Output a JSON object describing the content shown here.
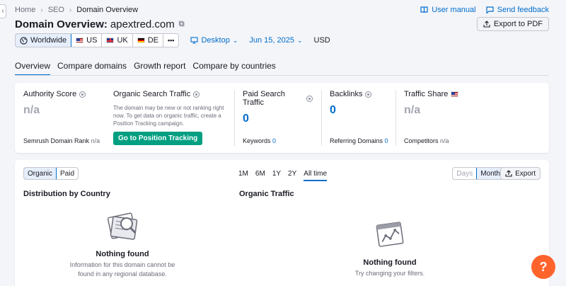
{
  "breadcrumb": [
    "Home",
    "SEO",
    "Domain Overview"
  ],
  "top_links": {
    "manual": "User manual",
    "feedback": "Send feedback"
  },
  "title": {
    "label": "Domain Overview:",
    "domain": "apextred.com"
  },
  "export_pdf": "Export to PDF",
  "regions": {
    "worldwide": "Worldwide",
    "us": "US",
    "uk": "UK",
    "de": "DE",
    "more": "•••"
  },
  "device": "Desktop",
  "date": "Jun 15, 2025",
  "currency": "USD",
  "tabs": [
    "Overview",
    "Compare domains",
    "Growth report",
    "Compare by countries"
  ],
  "metrics": {
    "authority": {
      "label": "Authority Score",
      "value": "n/a",
      "sub_label": "Semrush Domain Rank",
      "sub_value": "n/a"
    },
    "organic": {
      "label": "Organic Search Traffic",
      "note": "The domain may be new or not ranking right now. To get data on organic traffic, create a Position Tracking campaign.",
      "button": "Go to Position Tracking"
    },
    "paid": {
      "label": "Paid Search Traffic",
      "value": "0",
      "sub_label": "Keywords",
      "sub_value": "0"
    },
    "backlinks": {
      "label": "Backlinks",
      "value": "0",
      "sub_label": "Referring Domains",
      "sub_value": "0"
    },
    "share": {
      "label": "Traffic Share",
      "value": "n/a",
      "sub_label": "Competitors",
      "sub_value": "n/a"
    }
  },
  "main": {
    "type_toggle": [
      "Organic",
      "Paid"
    ],
    "ranges": [
      "1M",
      "6M",
      "1Y",
      "2Y",
      "All time"
    ],
    "granularity": [
      "Days",
      "Months"
    ],
    "export": "Export",
    "distribution": {
      "title": "Distribution by Country",
      "empty_title": "Nothing found",
      "empty_desc_1": "Information for this domain cannot be",
      "empty_desc_2": "found in any regional database."
    },
    "traffic": {
      "title": "Organic Traffic",
      "empty_title": "Nothing found",
      "empty_desc": "Try changing your filters."
    }
  },
  "help": "?",
  "colors": {
    "accent": "#006dca",
    "green": "#009f81",
    "help": "#ff642d"
  }
}
